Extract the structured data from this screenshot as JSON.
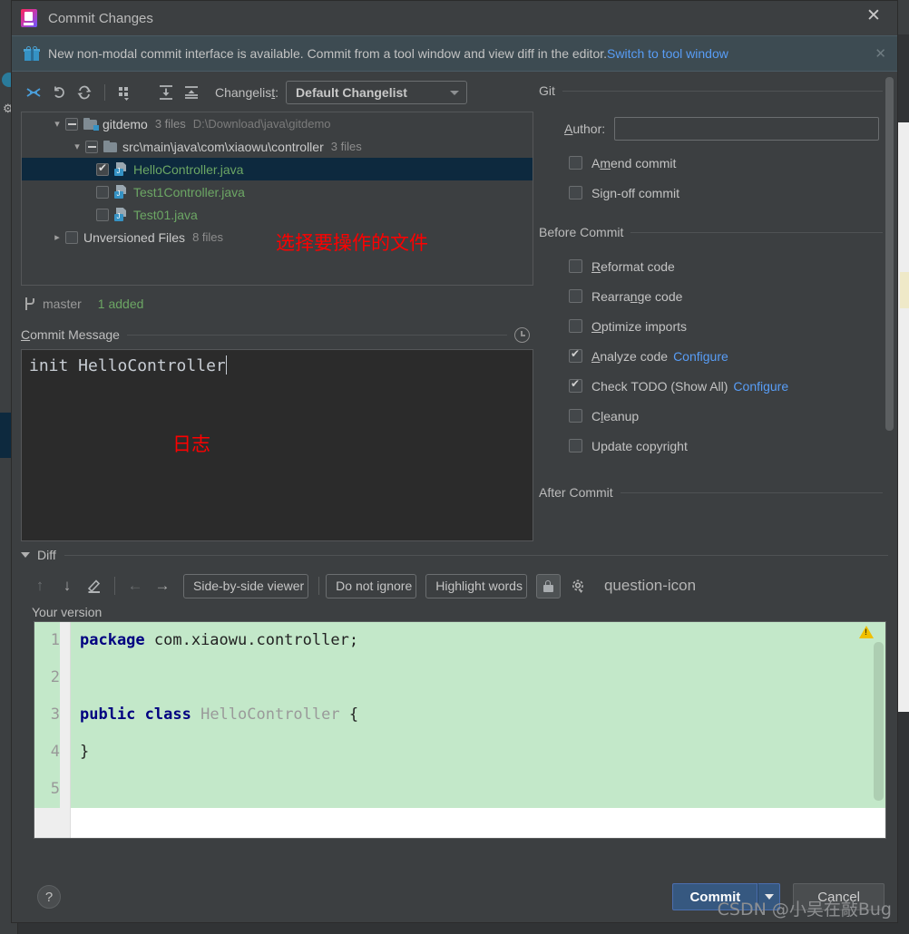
{
  "window": {
    "title": "Commit Changes",
    "app_icon": "intellij-idea-logo",
    "close_label": "✕"
  },
  "notification": {
    "icon": "gift-icon",
    "text": "New non-modal commit interface is available. Commit from a tool window and view diff in the editor.",
    "link_label": "Switch to tool window",
    "close_label": "✕"
  },
  "changes_toolbar": {
    "buttons": [
      {
        "name": "show-diff-icon",
        "glyph": "diff"
      },
      {
        "name": "rollback-icon",
        "glyph": "undo"
      },
      {
        "name": "refresh-icon",
        "glyph": "refresh"
      },
      {
        "name": "group-by-icon",
        "glyph": "group"
      },
      {
        "name": "expand-all-icon",
        "glyph": "expand"
      },
      {
        "name": "collapse-all-icon",
        "glyph": "collapse"
      }
    ],
    "changelist_label": "Changelist:",
    "changelist_value": "Default Changelist"
  },
  "file_tree": {
    "rows": [
      {
        "indent": 0,
        "twisty": "open",
        "checkbox": "partial",
        "icon": "module-folder-icon",
        "name": "gitdemo",
        "name_style": "plain",
        "meta": "3 files",
        "path": "D:\\Download\\java\\gitdemo",
        "selected": false
      },
      {
        "indent": 1,
        "twisty": "open",
        "checkbox": "partial",
        "icon": "folder-icon",
        "name": "src\\main\\java\\com\\xiaowu\\controller",
        "name_style": "plain",
        "meta": "3 files",
        "path": "",
        "selected": false
      },
      {
        "indent": 2,
        "twisty": "none",
        "checkbox": "checked",
        "icon": "java-file-icon",
        "name": "HelloController.java",
        "name_style": "java",
        "meta": "",
        "path": "",
        "selected": true
      },
      {
        "indent": 2,
        "twisty": "none",
        "checkbox": "unchecked",
        "icon": "java-file-icon",
        "name": "Test1Controller.java",
        "name_style": "java",
        "meta": "",
        "path": "",
        "selected": false
      },
      {
        "indent": 2,
        "twisty": "none",
        "checkbox": "unchecked",
        "icon": "java-file-icon",
        "name": "Test01.java",
        "name_style": "java",
        "meta": "",
        "path": "",
        "selected": false
      },
      {
        "indent": 0,
        "twisty": "closed",
        "checkbox": "unchecked",
        "icon": "none",
        "name": "Unversioned Files",
        "name_style": "plain",
        "meta": "8 files",
        "path": "",
        "selected": false
      }
    ]
  },
  "annotations": {
    "tree_note": "选择要操作的文件",
    "message_note": "日志",
    "color": "#ff0000"
  },
  "branch_status": {
    "icon": "git-branch-icon",
    "branch": "master",
    "stats": "1 added"
  },
  "commit_message": {
    "section_label": "Commit Message",
    "section_mnemonic": "C",
    "history_icon": "clock-icon",
    "value": "init HelloController"
  },
  "git_panel": {
    "group_label": "Git",
    "author_label": "Author:",
    "author_mnemonic": "A",
    "author_value": "",
    "author_placeholder": "",
    "options": [
      {
        "label": "Amend commit",
        "checked": false,
        "mnemonic": "m"
      },
      {
        "label": "Sign-off commit",
        "checked": false,
        "mnemonic": "g"
      }
    ]
  },
  "before_commit": {
    "group_label": "Before Commit",
    "options": [
      {
        "label": "Reformat code",
        "checked": false,
        "mnemonic": "R",
        "configure": ""
      },
      {
        "label": "Rearrange code",
        "checked": false,
        "mnemonic": "n",
        "configure": ""
      },
      {
        "label": "Optimize imports",
        "checked": false,
        "mnemonic": "O",
        "configure": ""
      },
      {
        "label": "Analyze code",
        "checked": true,
        "mnemonic": "A",
        "configure": "Configure"
      },
      {
        "label": "Check TODO (Show All)",
        "checked": true,
        "mnemonic": "",
        "configure": "Configure"
      },
      {
        "label": "Cleanup",
        "checked": false,
        "mnemonic": "l",
        "configure": ""
      },
      {
        "label": "Update copyright",
        "checked": false,
        "mnemonic": "",
        "configure": ""
      }
    ]
  },
  "after_commit": {
    "group_label": "After Commit"
  },
  "diff_section": {
    "section_label": "Diff",
    "collapsed": false,
    "toolbar": {
      "prev_diff_icon": "arrow-up-icon",
      "next_diff_icon": "arrow-down-icon",
      "edit_icon": "pencil-icon",
      "accept_left_icon": "arrow-left-icon",
      "accept_right_icon": "arrow-right-icon",
      "viewer_mode": "Side-by-side viewer",
      "ignore_mode": "Do not ignore",
      "highlight_mode": "Highlight words",
      "lock_icon": "lock-icon",
      "settings_icon": "gear-icon",
      "help_icon": "question-icon"
    },
    "pane_title": "Your version",
    "warning_icon": "warning-triangle-icon",
    "code": {
      "language": "java",
      "lines": [
        {
          "no": "1",
          "added": true,
          "tokens": [
            {
              "t": "package",
              "k": "kw"
            },
            {
              "t": " com.xiaowu.controller;",
              "k": "pl"
            }
          ]
        },
        {
          "no": "2",
          "added": true,
          "tokens": []
        },
        {
          "no": "3",
          "added": true,
          "tokens": [
            {
              "t": "public class",
              "k": "kw"
            },
            {
              "t": " ",
              "k": "pl"
            },
            {
              "t": "HelloController",
              "k": "cls"
            },
            {
              "t": " {",
              "k": "pl"
            }
          ]
        },
        {
          "no": "4",
          "added": true,
          "tokens": [
            {
              "t": "}",
              "k": "pl"
            }
          ]
        },
        {
          "no": "5",
          "added": true,
          "tokens": []
        }
      ]
    }
  },
  "footer": {
    "help_label": "?",
    "commit_label": "Commit",
    "commit_dropdown_label": "▾",
    "cancel_label": "Cancel",
    "accent_color": "#365880"
  },
  "watermark": {
    "text": "CSDN @小吴在敲Bug"
  }
}
